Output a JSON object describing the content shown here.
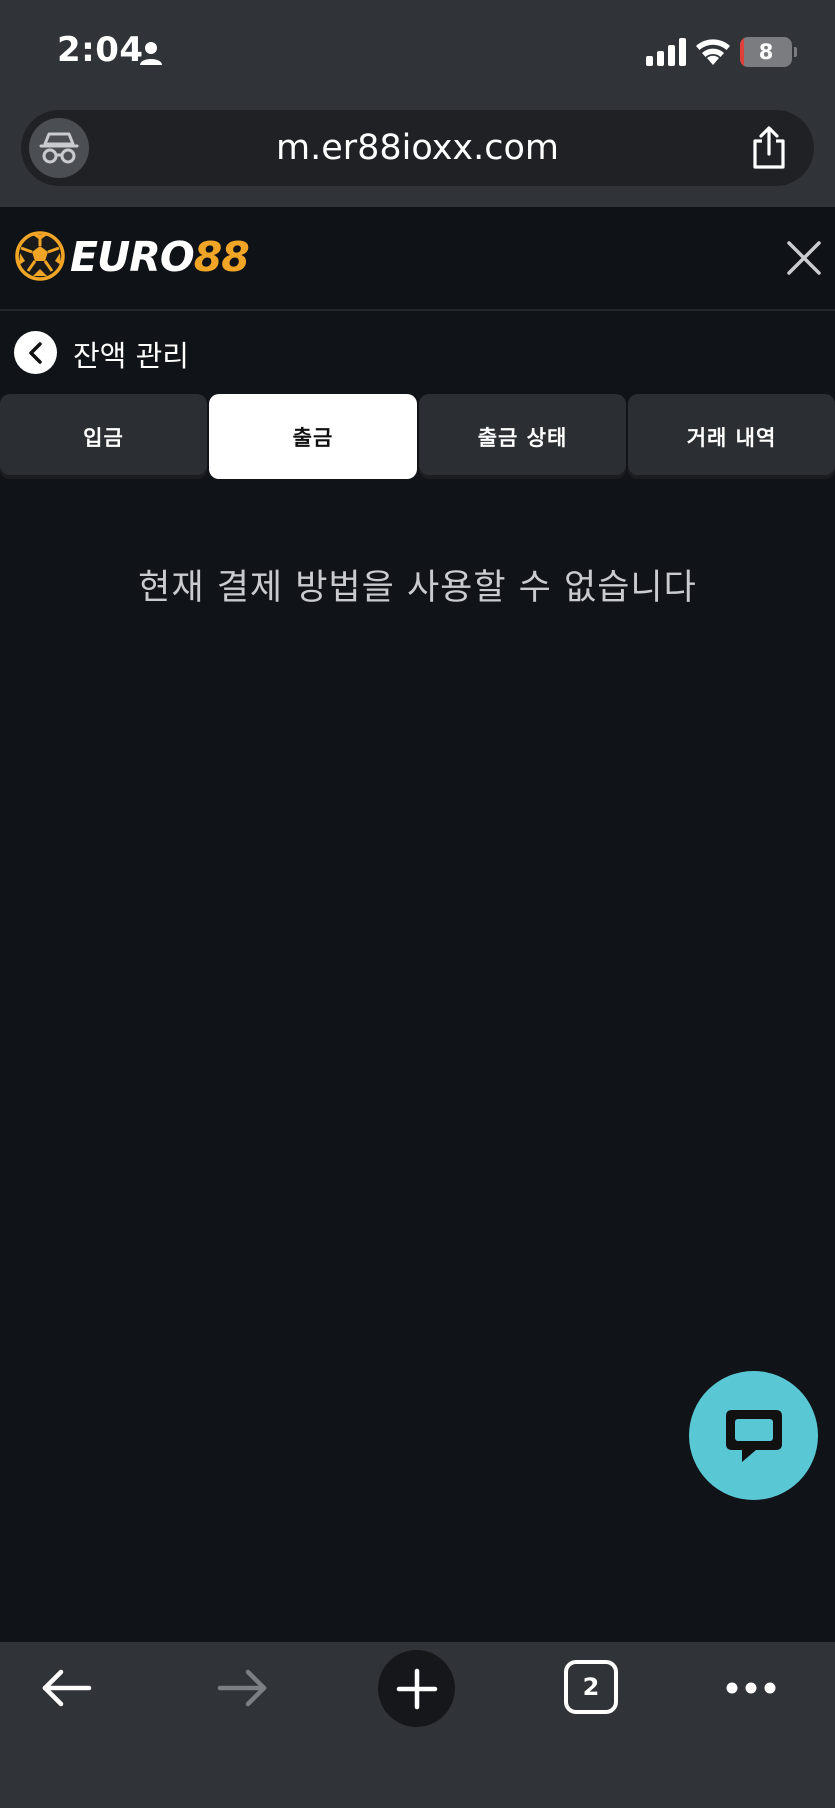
{
  "status_bar": {
    "time": "2:04",
    "battery_level": "8",
    "battery_fraction": 0.08
  },
  "browser": {
    "url": "m.er88ioxx.com",
    "open_tabs": "2"
  },
  "site": {
    "logo_primary": "EURO",
    "logo_accent": "88",
    "brand_color": "#f0a526"
  },
  "page": {
    "title": "잔액 관리",
    "tabs": [
      {
        "label": "입금",
        "active": false
      },
      {
        "label": "출금",
        "active": true
      },
      {
        "label": "출금 상태",
        "active": false
      },
      {
        "label": "거래 내역",
        "active": false
      }
    ],
    "empty_message": "현재 결제 방법을 사용할 수 없습니다"
  },
  "icons": {
    "person": "person-icon",
    "signal": "cellular-signal-icon",
    "wifi": "wifi-icon",
    "battery": "battery-icon",
    "incognito": "incognito-icon",
    "share": "share-icon",
    "logo": "soccer-ball-icon",
    "close": "close-icon",
    "back": "chevron-left-icon",
    "chat": "chat-bubble-icon",
    "nav_back": "arrow-left-icon",
    "nav_forward": "arrow-right-icon",
    "new_tab": "plus-icon",
    "tabs": "tab-count-icon",
    "more": "more-horizontal-icon"
  },
  "colors": {
    "chat_fab": "#5ac7d5",
    "battery_low": "#e0403a"
  }
}
